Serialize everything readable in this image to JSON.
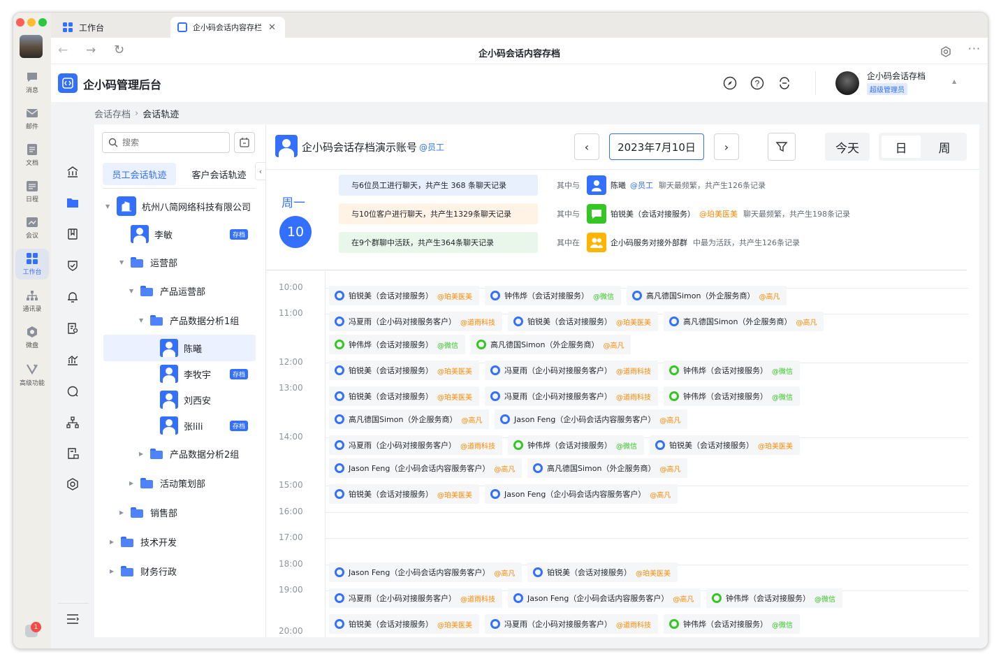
{
  "browser": {
    "tabs": [
      {
        "label": "工作台"
      },
      {
        "label": "企小码会话内容存档",
        "short": "企小码会话内容存栏"
      }
    ],
    "page_title": "企小码会话内容存档"
  },
  "rail": {
    "items": [
      {
        "label": "消息",
        "icon": "chat-bubble-icon"
      },
      {
        "label": "邮件",
        "icon": "mail-icon"
      },
      {
        "label": "文档",
        "icon": "doc-icon"
      },
      {
        "label": "日程",
        "icon": "calendar-icon"
      },
      {
        "label": "会议",
        "icon": "meeting-icon"
      },
      {
        "label": "工作台",
        "icon": "grid-icon",
        "active": true
      },
      {
        "label": "通讯录",
        "icon": "contacts-icon"
      },
      {
        "label": "微盘",
        "icon": "drive-icon"
      },
      {
        "label": "高级功能",
        "icon": "advanced-icon"
      }
    ],
    "notification_count": "1"
  },
  "app": {
    "title": "企小码管理后台",
    "user_name": "企小码会话存档",
    "user_role": "超级管理员"
  },
  "breadcrumb": {
    "root": "会话存档",
    "current": "会话轨迹"
  },
  "tree": {
    "search_placeholder": "搜索",
    "tabs": [
      {
        "label": "员工会话轨迹",
        "active": true
      },
      {
        "label": "客户会话轨迹"
      }
    ],
    "nodes": [
      {
        "label": "杭州八简网络科技有限公司",
        "type": "company"
      },
      {
        "label": "李敏",
        "type": "person",
        "badge": "存档"
      },
      {
        "label": "运营部",
        "type": "folder"
      },
      {
        "label": "产品运营部",
        "type": "folder"
      },
      {
        "label": "产品数据分析1组",
        "type": "folder"
      },
      {
        "label": "陈曦",
        "type": "person",
        "selected": true
      },
      {
        "label": "李牧宇",
        "type": "person",
        "badge": "存档"
      },
      {
        "label": "刘西安",
        "type": "person"
      },
      {
        "label": "张lili",
        "type": "person",
        "badge": "存档"
      },
      {
        "label": "产品数据分析2组",
        "type": "folder"
      },
      {
        "label": "活动策划部",
        "type": "folder"
      },
      {
        "label": "销售部",
        "type": "folder"
      },
      {
        "label": "技术开发",
        "type": "folder"
      },
      {
        "label": "财务行政",
        "type": "folder"
      }
    ]
  },
  "main": {
    "account_name": "企小码会话存档演示账号",
    "account_tag": "@员工",
    "date": "2023年7月10日",
    "today_label": "今天",
    "view_day": "日",
    "view_week": "周",
    "weekday": "周一",
    "day_number": "10",
    "summaries": [
      {
        "text": "与6位员工进行聊天，共产生 368 条聊天记录",
        "bg": "#e8f0fe"
      },
      {
        "text": "与10位客户进行聊天，共产生1329条聊天记录",
        "bg": "#fff3e6"
      },
      {
        "text": "在9个群聊中活跃，共产生364条聊天记录",
        "bg": "#e8f7ea"
      }
    ],
    "highlights": [
      {
        "prefix": "其中与",
        "name": "陈曦",
        "tag": "@员工",
        "suffix": "聊天最频繁，共产生126条记录"
      },
      {
        "prefix": "其中与",
        "name": "铂锐美（会话对接服务）",
        "tag": "@珀美医美",
        "suffix": "聊天最频繁，共产生198条记录"
      },
      {
        "prefix": "其中在",
        "name": "企小码服务对接外部群",
        "tag": "",
        "suffix": "中最为活跃，共产生126条记录"
      }
    ],
    "times": [
      "10:00",
      "11:00",
      "12:00",
      "13:00",
      "14:00",
      "15:00",
      "16:00",
      "17:00",
      "18:00",
      "19:00",
      "20:00"
    ],
    "rows": [
      [
        {
          "n": "铂锐美（会话对接服务）",
          "t": "@珀美医美"
        },
        {
          "n": "钟伟烨（会话对接服务）",
          "t": "@微信",
          "g": true
        },
        {
          "n": "高凡德国Simon（外企服务商）",
          "t": "@高凡"
        }
      ],
      [
        {
          "n": "冯夏雨（企小码对接服务客户）",
          "t": "@道雨科技"
        },
        {
          "n": "铂锐美（会话对接服务）",
          "t": "@珀美医美"
        },
        {
          "n": "高凡德国Simon（外企服务商）",
          "t": "@高凡"
        }
      ],
      [
        {
          "n": "钟伟烨（会话对接服务）",
          "t": "@微信",
          "g": true,
          "gr": true
        },
        {
          "n": "高凡德国Simon（外企服务商）",
          "t": "@高凡",
          "gr": true
        }
      ],
      [
        {
          "n": "铂锐美（会话对接服务）",
          "t": "@珀美医美"
        },
        {
          "n": "冯夏雨（企小码对接服务客户）",
          "t": "@道雨科技"
        },
        {
          "n": "钟伟烨（会话对接服务）",
          "t": "@微信",
          "g": true,
          "gr": true
        }
      ],
      [
        {
          "n": "铂锐美（会话对接服务）",
          "t": "@珀美医美"
        },
        {
          "n": "冯夏雨（企小码对接服务客户）",
          "t": "@道雨科技"
        },
        {
          "n": "钟伟烨（会话对接服务）",
          "t": "@微信",
          "g": true,
          "gr": true
        }
      ],
      [
        {
          "n": "高凡德国Simon（外企服务商）",
          "t": "@高凡"
        },
        {
          "n": "Jason Feng（企小码会话内容服务客户）",
          "t": "@高凡"
        }
      ],
      [
        {
          "n": "冯夏雨（企小码对接服务客户）",
          "t": "@道雨科技"
        },
        {
          "n": "钟伟烨（会话对接服务）",
          "t": "@微信",
          "g": true,
          "gr": true
        },
        {
          "n": "铂锐美（会话对接服务）",
          "t": "@珀美医美"
        }
      ],
      [
        {
          "n": "Jason Feng（企小码会话内容服务客户）",
          "t": "@高凡"
        },
        {
          "n": "高凡德国Simon（外企服务商）",
          "t": "@高凡"
        }
      ],
      [
        {
          "n": "铂锐美（会话对接服务）",
          "t": "@珀美医美"
        },
        {
          "n": "Jason Feng（企小码会话内容服务客户）",
          "t": "@高凡"
        }
      ],
      [
        {
          "n": "Jason Feng（企小码会话内容服务客户）",
          "t": "@高凡"
        },
        {
          "n": "铂锐美（会话对接服务）",
          "t": "@珀美医美"
        }
      ],
      [
        {
          "n": "冯夏雨（企小码对接服务客户）",
          "t": "@道雨科技"
        },
        {
          "n": "Jason Feng（企小码会话内容服务客户）",
          "t": "@高凡"
        },
        {
          "n": "钟伟烨（会话对接服务）",
          "t": "@微信",
          "g": true,
          "gr": true
        }
      ],
      [
        {
          "n": "铂锐美（会话对接服务）",
          "t": "@珀美医美"
        },
        {
          "n": "冯夏雨（企小码对接服务客户）",
          "t": "@道雨科技"
        },
        {
          "n": "钟伟烨（会话对接服务）",
          "t": "@微信",
          "g": true,
          "gr": true
        }
      ]
    ]
  }
}
